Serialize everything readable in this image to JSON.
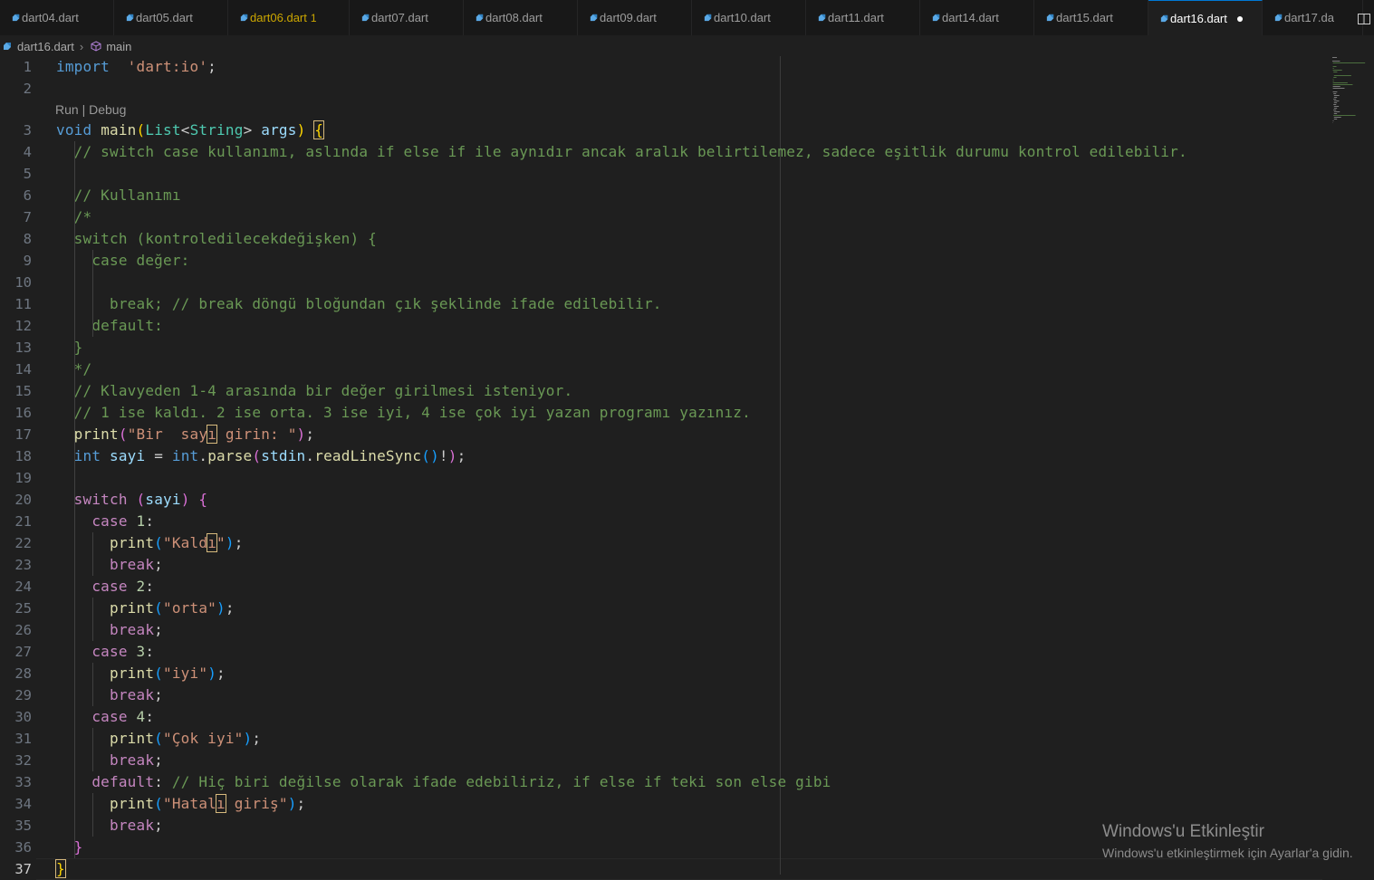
{
  "tabs": [
    {
      "label": "dart04.dart",
      "state": "normal"
    },
    {
      "label": "dart05.dart",
      "state": "normal"
    },
    {
      "label": "dart06.dart",
      "state": "modified",
      "badge": "1"
    },
    {
      "label": "dart07.dart",
      "state": "normal"
    },
    {
      "label": "dart08.dart",
      "state": "normal"
    },
    {
      "label": "dart09.dart",
      "state": "normal"
    },
    {
      "label": "dart10.dart",
      "state": "normal"
    },
    {
      "label": "dart11.dart",
      "state": "normal"
    },
    {
      "label": "dart14.dart",
      "state": "normal"
    },
    {
      "label": "dart15.dart",
      "state": "normal"
    },
    {
      "label": "dart16.dart",
      "state": "active"
    },
    {
      "label": "dart17.da",
      "state": "normal"
    }
  ],
  "breadcrumb": {
    "file": "dart16.dart",
    "symbol": "main"
  },
  "codelens": {
    "run": "Run",
    "sep": " | ",
    "debug": "Debug"
  },
  "colors": {
    "accent": "#0078d4",
    "modified": "#cca700",
    "dart_icon": "#5aa9e6"
  },
  "icons": {
    "tab_file": "dart-file-icon",
    "symbol": "cube-method-icon",
    "split": "split-editor-icon"
  },
  "lines": [
    {
      "n": 1,
      "tokens": [
        [
          "kw",
          "import"
        ],
        [
          "",
          "  "
        ],
        [
          "str",
          "'dart:io'"
        ],
        [
          "",
          ";"
        ]
      ]
    },
    {
      "n": 2,
      "tokens": []
    },
    {
      "n": 3,
      "tokens": [
        [
          "kw",
          "void"
        ],
        [
          "",
          " "
        ],
        [
          "fn",
          "main"
        ],
        [
          "p1",
          "("
        ],
        [
          "typ",
          "List"
        ],
        [
          "",
          "<"
        ],
        [
          "typ",
          "String"
        ],
        [
          "",
          "> "
        ],
        [
          "var",
          "args"
        ],
        [
          "p1",
          ")"
        ],
        [
          "",
          " "
        ],
        [
          "p1 hl-box",
          "{"
        ]
      ]
    },
    {
      "n": 4,
      "tokens": [
        [
          "",
          "  "
        ],
        [
          "cmt",
          "// switch case kullanımı, aslında if else if ile aynıdır ancak aralık belirtilemez, sadece eşitlik durumu kontrol edilebilir."
        ]
      ]
    },
    {
      "n": 5,
      "tokens": []
    },
    {
      "n": 6,
      "tokens": [
        [
          "",
          "  "
        ],
        [
          "cmt",
          "// Kullanımı"
        ]
      ]
    },
    {
      "n": 7,
      "tokens": [
        [
          "",
          "  "
        ],
        [
          "cmt",
          "/*"
        ]
      ]
    },
    {
      "n": 8,
      "tokens": [
        [
          "",
          "  "
        ],
        [
          "cmt",
          "switch (kontroledilecekdeğişken) {"
        ]
      ]
    },
    {
      "n": 9,
      "tokens": [
        [
          "",
          "    "
        ],
        [
          "cmt",
          "case değer:"
        ]
      ]
    },
    {
      "n": 10,
      "tokens": []
    },
    {
      "n": 11,
      "tokens": [
        [
          "",
          "      "
        ],
        [
          "cmt",
          "break; // break döngü bloğundan çık şeklinde ifade edilebilir."
        ]
      ]
    },
    {
      "n": 12,
      "tokens": [
        [
          "",
          "    "
        ],
        [
          "cmt",
          "default:"
        ]
      ]
    },
    {
      "n": 13,
      "tokens": [
        [
          "",
          "  "
        ],
        [
          "cmt",
          "}"
        ]
      ]
    },
    {
      "n": 14,
      "tokens": [
        [
          "",
          "  "
        ],
        [
          "cmt",
          "*/"
        ]
      ]
    },
    {
      "n": 15,
      "tokens": [
        [
          "",
          "  "
        ],
        [
          "cmt",
          "// Klavyeden 1-4 arasında bir değer girilmesi isteniyor."
        ]
      ]
    },
    {
      "n": 16,
      "tokens": [
        [
          "",
          "  "
        ],
        [
          "cmt",
          "// 1 ise kaldı. 2 ise orta. 3 ise iyi, 4 ise çok iyi yazan programı yazınız."
        ]
      ]
    },
    {
      "n": 17,
      "tokens": [
        [
          "",
          "  "
        ],
        [
          "fn",
          "print"
        ],
        [
          "p2",
          "("
        ],
        [
          "str",
          "\"Bir  say"
        ],
        [
          "str hl-box",
          "ı"
        ],
        [
          "str",
          " girin: \""
        ],
        [
          "p2",
          ")"
        ],
        [
          "",
          ";"
        ]
      ]
    },
    {
      "n": 18,
      "tokens": [
        [
          "",
          "  "
        ],
        [
          "kw",
          "int"
        ],
        [
          "",
          " "
        ],
        [
          "var",
          "sayi"
        ],
        [
          "",
          " = "
        ],
        [
          "kw",
          "int"
        ],
        [
          "",
          "."
        ],
        [
          "fn",
          "parse"
        ],
        [
          "p2",
          "("
        ],
        [
          "var",
          "stdin"
        ],
        [
          "",
          "."
        ],
        [
          "fn",
          "readLineSync"
        ],
        [
          "p3",
          "()"
        ],
        [
          "",
          "!"
        ],
        [
          "p2",
          ")"
        ],
        [
          "",
          ";"
        ]
      ]
    },
    {
      "n": 19,
      "tokens": []
    },
    {
      "n": 20,
      "tokens": [
        [
          "",
          "  "
        ],
        [
          "ctl",
          "switch"
        ],
        [
          "",
          " "
        ],
        [
          "p2",
          "("
        ],
        [
          "var",
          "sayi"
        ],
        [
          "p2",
          ")"
        ],
        [
          "",
          " "
        ],
        [
          "p2",
          "{"
        ]
      ]
    },
    {
      "n": 21,
      "tokens": [
        [
          "",
          "    "
        ],
        [
          "ctl",
          "case"
        ],
        [
          "",
          " "
        ],
        [
          "num",
          "1"
        ],
        [
          "",
          ":"
        ]
      ]
    },
    {
      "n": 22,
      "tokens": [
        [
          "",
          "      "
        ],
        [
          "fn",
          "print"
        ],
        [
          "p3",
          "("
        ],
        [
          "str",
          "\"Kald"
        ],
        [
          "str hl-box",
          "ı"
        ],
        [
          "str",
          "\""
        ],
        [
          "p3",
          ")"
        ],
        [
          "",
          ";"
        ]
      ]
    },
    {
      "n": 23,
      "tokens": [
        [
          "",
          "      "
        ],
        [
          "ctl",
          "break"
        ],
        [
          "",
          ";"
        ]
      ]
    },
    {
      "n": 24,
      "tokens": [
        [
          "",
          "    "
        ],
        [
          "ctl",
          "case"
        ],
        [
          "",
          " "
        ],
        [
          "num",
          "2"
        ],
        [
          "",
          ":"
        ]
      ]
    },
    {
      "n": 25,
      "tokens": [
        [
          "",
          "      "
        ],
        [
          "fn",
          "print"
        ],
        [
          "p3",
          "("
        ],
        [
          "str",
          "\"orta\""
        ],
        [
          "p3",
          ")"
        ],
        [
          "",
          ";"
        ]
      ]
    },
    {
      "n": 26,
      "tokens": [
        [
          "",
          "      "
        ],
        [
          "ctl",
          "break"
        ],
        [
          "",
          ";"
        ]
      ]
    },
    {
      "n": 27,
      "tokens": [
        [
          "",
          "    "
        ],
        [
          "ctl",
          "case"
        ],
        [
          "",
          " "
        ],
        [
          "num",
          "3"
        ],
        [
          "",
          ":"
        ]
      ]
    },
    {
      "n": 28,
      "tokens": [
        [
          "",
          "      "
        ],
        [
          "fn",
          "print"
        ],
        [
          "p3",
          "("
        ],
        [
          "str",
          "\"iyi\""
        ],
        [
          "p3",
          ")"
        ],
        [
          "",
          ";"
        ]
      ]
    },
    {
      "n": 29,
      "tokens": [
        [
          "",
          "      "
        ],
        [
          "ctl",
          "break"
        ],
        [
          "",
          ";"
        ]
      ]
    },
    {
      "n": 30,
      "tokens": [
        [
          "",
          "    "
        ],
        [
          "ctl",
          "case"
        ],
        [
          "",
          " "
        ],
        [
          "num",
          "4"
        ],
        [
          "",
          ":"
        ]
      ]
    },
    {
      "n": 31,
      "tokens": [
        [
          "",
          "      "
        ],
        [
          "fn",
          "print"
        ],
        [
          "p3",
          "("
        ],
        [
          "str",
          "\"Çok iyi\""
        ],
        [
          "p3",
          ")"
        ],
        [
          "",
          ";"
        ]
      ]
    },
    {
      "n": 32,
      "tokens": [
        [
          "",
          "      "
        ],
        [
          "ctl",
          "break"
        ],
        [
          "",
          ";"
        ]
      ]
    },
    {
      "n": 33,
      "tokens": [
        [
          "",
          "    "
        ],
        [
          "ctl",
          "default"
        ],
        [
          "",
          ": "
        ],
        [
          "cmt",
          "// Hiç biri değilse olarak ifade edebiliriz, if else if teki son else gibi"
        ]
      ]
    },
    {
      "n": 34,
      "tokens": [
        [
          "",
          "      "
        ],
        [
          "fn",
          "print"
        ],
        [
          "p3",
          "("
        ],
        [
          "str",
          "\"Hatal"
        ],
        [
          "str hl-box",
          "ı"
        ],
        [
          "str",
          " giriş\""
        ],
        [
          "p3",
          ")"
        ],
        [
          "",
          ";"
        ]
      ]
    },
    {
      "n": 35,
      "tokens": [
        [
          "",
          "      "
        ],
        [
          "ctl",
          "break"
        ],
        [
          "",
          ";"
        ]
      ]
    },
    {
      "n": 36,
      "tokens": [
        [
          "",
          "  "
        ],
        [
          "p2",
          "}"
        ]
      ]
    },
    {
      "n": 37,
      "tokens": [
        [
          "p1 hl-box",
          "}"
        ]
      ]
    }
  ],
  "current_line": 37,
  "watermark": {
    "title": "Windows'u Etkinleştir",
    "subtitle": "Windows'u etkinleştirmek için Ayarlar'a gidin."
  }
}
